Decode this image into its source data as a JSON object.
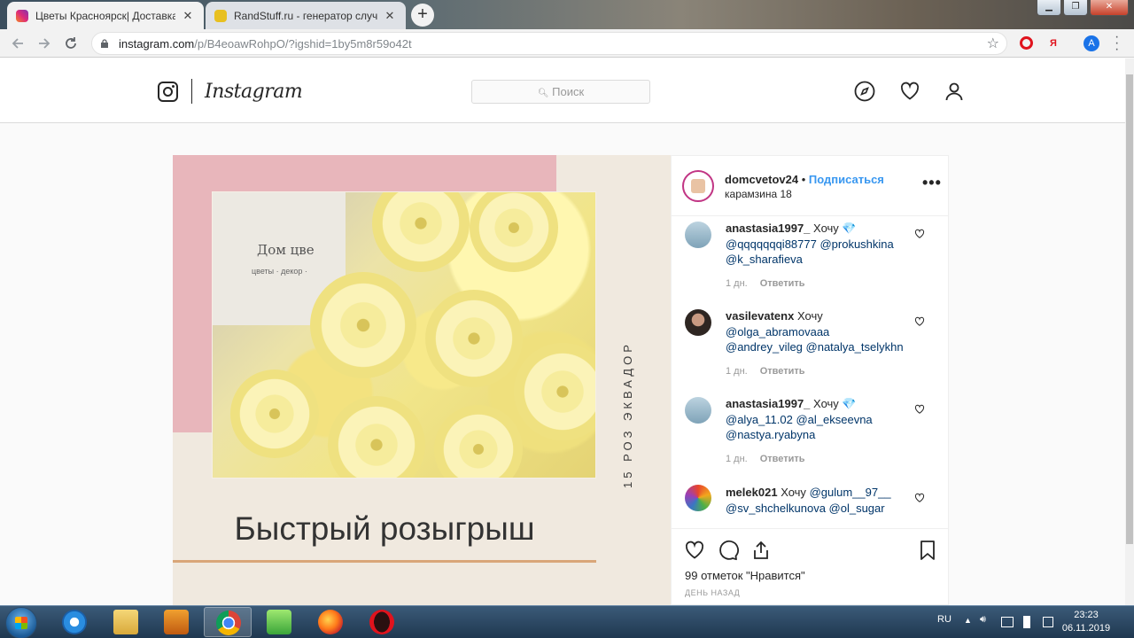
{
  "browser": {
    "tabs": [
      {
        "title": "Цветы Красноярск| Доставка в",
        "active": true
      },
      {
        "title": "RandStuff.ru - генератор случай",
        "active": false
      }
    ],
    "new_tab_label": "+",
    "close_label": "✕",
    "back_icon": "arrow-left-icon",
    "forward_icon": "arrow-right-icon",
    "reload_icon": "reload-icon",
    "url_host": "instagram.com",
    "url_path": "/p/B4eoawRohpO/?igshid=1by5m8r59o42t",
    "ext_yandex_label": "Я",
    "profile_initial": "A",
    "window_min": "▁",
    "window_max": "❐",
    "window_close": "✕"
  },
  "instagram": {
    "wordmark": "Instagram",
    "search_placeholder": "Поиск",
    "post": {
      "sign_title": "Дом цве",
      "sign_sub": "цветы · декор ·",
      "side_text": "15 РОЗ ЭКВАДОР",
      "image_title": "Быстрый розыгрыш",
      "username": "domcvetov24",
      "follow_label": "Подписаться",
      "location": "карамзина 18",
      "more_label": "•••",
      "comments": [
        {
          "user": "anastasia1997_",
          "text": "Хочу 💎",
          "mentions": "@qqqqqqqi88777 @prokushkina @k_sharafieva",
          "time": "1 дн.",
          "reply": "Ответить",
          "avatar_color": "#9ab7c9"
        },
        {
          "user": "vasilevatenx",
          "text": "Хочу",
          "mentions": "@olga_abramovaaa @andrey_vileg @natalya_tselykhn",
          "time": "1 дн.",
          "reply": "Ответить",
          "avatar_color": "#3a3330"
        },
        {
          "user": "anastasia1997_",
          "text": "Хочу 💎",
          "mentions": "@alya_11.02 @al_ekseevna @nastya.ryabyna",
          "time": "1 дн.",
          "reply": "Ответить",
          "avatar_color": "#9ab7c9"
        },
        {
          "user": "melek021",
          "text": "Хочу",
          "mentions": "@gulum__97__ @sv_shchelkunova @ol_sugar",
          "time": "",
          "reply": "",
          "avatar_color": "#e07b2f"
        }
      ],
      "likes_text": "99 отметок \"Нравится\"",
      "time_ago": "день назад"
    }
  },
  "taskbar": {
    "language": "RU",
    "time": "23:23",
    "date": "06.11.2019"
  },
  "colors": {
    "link_blue": "#3897f0",
    "mention_blue": "#003569",
    "pink_block": "#e8b6bb",
    "beige_bg": "#f0e9df",
    "underline": "#d9a679"
  }
}
